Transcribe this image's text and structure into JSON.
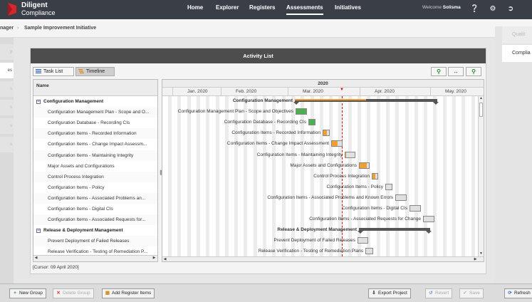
{
  "nav": {
    "brand_line1": "Diligent",
    "brand_line2": "Compliance",
    "items": [
      "Home",
      "Explorer",
      "Registers",
      "Assessments",
      "Initiatives"
    ],
    "active": "Assessments",
    "welcome_prefix": "Welcome",
    "user": "Solisma",
    "icons": [
      "help-icon",
      "settings-icon",
      "logout-icon"
    ]
  },
  "breadcrumb": {
    "parent": "nager",
    "current": "Sample Improvement Initiative"
  },
  "left_rail": [
    "y",
    "es",
    "s",
    "s",
    "s",
    "s"
  ],
  "right_rail": [
    "Qualit",
    "Complia"
  ],
  "panel": {
    "title": "Activity List",
    "task_list_label": "Task List",
    "timeline_label": "Timeline",
    "zoom_icons": [
      "zoom-in-icon",
      "fit-width-icon",
      "zoom-out-icon"
    ],
    "name_header": "Name",
    "cursor_info": "[Cursor: 09 April 2020]"
  },
  "tasks": [
    {
      "name": "Configuration Management",
      "group": true
    },
    {
      "name": "Configuration Management Plan - Scope and O...",
      "group": false
    },
    {
      "name": "Configuration Database - Recording CIs",
      "group": false
    },
    {
      "name": "Configuration Items - Recorded Information",
      "group": false
    },
    {
      "name": "Configuration Items - Change Impact Assessm...",
      "group": false
    },
    {
      "name": "Configuration Items - Maintaining Integrity",
      "group": false
    },
    {
      "name": "Major Assets and Configurations",
      "group": false
    },
    {
      "name": "Control Process Integration",
      "group": false
    },
    {
      "name": "Configuration Items - Policy",
      "group": false
    },
    {
      "name": "Configuration Items - Associated Problems an...",
      "group": false
    },
    {
      "name": "Configuration Items - Digital CIs",
      "group": false
    },
    {
      "name": "Configuration Items - Associated Requests for...",
      "group": false
    },
    {
      "name": "Release & Deployment Management",
      "group": true
    },
    {
      "name": "Prevent Deployment of Failed Releases",
      "group": false
    },
    {
      "name": "Release Verification - Testing of Remediation P...",
      "group": false
    }
  ],
  "timeline": {
    "year": "2020",
    "months": [
      "Jan. 2020",
      "Feb. 2020",
      "Mar. 2020",
      "Apr. 2020",
      "May. 2020"
    ],
    "rows": [
      {
        "label": "Configuration Management",
        "summary": true,
        "progress": 0.5
      },
      {
        "label": "Configuration Management Plan - Scope and Objectives",
        "progress": 1.0,
        "color": "#4caf50"
      },
      {
        "label": "Configuration Database - Recording CIs",
        "progress": 1.0,
        "color": "#4caf50"
      },
      {
        "label": "Configuration Items - Recorded Information",
        "progress": 0.6,
        "color": "#f0a030"
      },
      {
        "label": "Configuration Items - Change Impact Assessment",
        "progress": 0.6,
        "color": "#f0a030"
      },
      {
        "label": "Configuration Items - Maintaining Integrity",
        "progress": 0.1,
        "color": "#f0a030"
      },
      {
        "label": "Major Assets and Configurations",
        "progress": 0.8,
        "color": "#f0a030"
      },
      {
        "label": "Control Process Integration",
        "progress": 0.5,
        "color": "#f0a030"
      },
      {
        "label": "Configuration Items - Policy",
        "progress": 0.0,
        "color": "#f0a030"
      },
      {
        "label": "Configuration Items - Associated Problems and Known Errors",
        "progress": 0.0,
        "color": "#f0a030"
      },
      {
        "label": "Configuration Items - Digital CIs",
        "progress": 0.0,
        "color": "#f0a030"
      },
      {
        "label": "Configuration Items - Associated Requests for Change",
        "progress": 0.0,
        "color": "#f0a030"
      },
      {
        "label": "Release & Deployment Management",
        "summary": true,
        "progress": 0.0
      },
      {
        "label": "Prevent Deployment of Failed Releases",
        "progress": 0.0,
        "color": "#f0a030"
      },
      {
        "label": "Release Verification - Testing of Remediation Plans",
        "progress": 0.0,
        "color": "#f0a030"
      }
    ]
  },
  "toolbar": {
    "new_group": "New Group",
    "delete_group": "Delete Group",
    "add_register_items": "Add Register Items",
    "export_project": "Export Project",
    "revert": "Revert",
    "save": "Save",
    "refresh": "Refresh"
  },
  "colors": {
    "topbar": "#3a3f47",
    "accent_green": "#4caf50",
    "accent_orange": "#f0a030",
    "cursor_red": "#dd0000"
  }
}
